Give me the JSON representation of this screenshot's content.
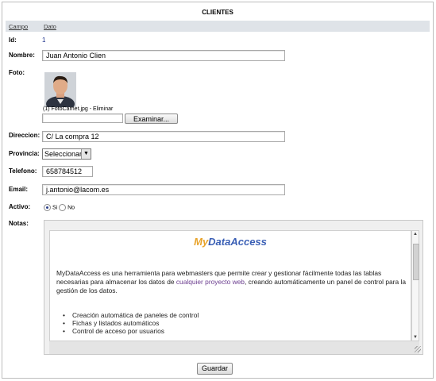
{
  "form": {
    "title": "CLIENTES",
    "header": {
      "campo": "Campo",
      "dato": "Dato"
    },
    "id": {
      "label": "Id:",
      "value": "1"
    },
    "nombre": {
      "label": "Nombre:",
      "value": "Juan Antonio Clien"
    },
    "foto": {
      "label": "Foto:",
      "caption": "(1) FotoCarnet.jpg - Eliminar",
      "browse_label": "Examinar..."
    },
    "direccion": {
      "label": "Direccion:",
      "value": "C/ La compra 12"
    },
    "provincia": {
      "label": "Provincia:",
      "selected": "Seleccionar"
    },
    "telefono": {
      "label": "Telefono:",
      "value": "658784512"
    },
    "email": {
      "label": "Email:",
      "value": "j.antonio@lacom.es"
    },
    "activo": {
      "label": "Activo:",
      "option_si": "Si",
      "option_no": "No",
      "selected": "Si"
    },
    "notas": {
      "label": "Notas:",
      "logo_my": "My",
      "logo_rest": "DataAccess",
      "paragraph_before_link": "MyDataAccess es una herramienta para webmasters que permite crear y gestionar fácilmente todas las tablas necesarias para almacenar los datos de ",
      "paragraph_link": "cualquier proyecto web",
      "paragraph_after_link": ", creando automáticamente un panel de control para la gestión de los datos.",
      "bullets": [
        "Creación automática de paneles de control",
        "Fichas y listados automáticos",
        "Control de acceso por usuarios"
      ]
    },
    "save_label": "Guardar"
  },
  "colors": {
    "header_bg": "#dfe3e8",
    "logo_orange": "#e8a32a",
    "logo_blue": "#3a5fb5",
    "link_purple": "#6b3d8f"
  }
}
